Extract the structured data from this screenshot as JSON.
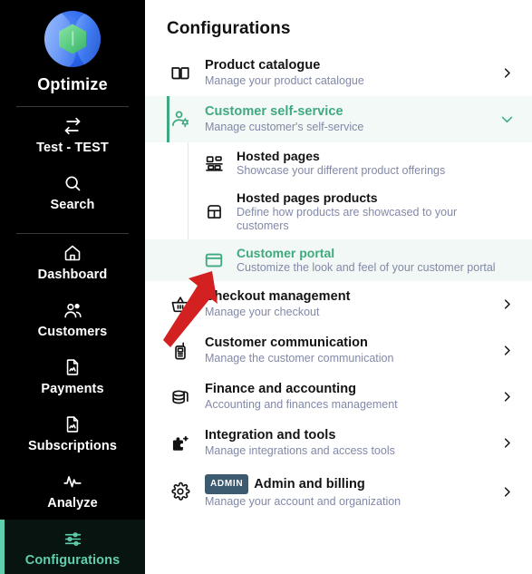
{
  "sidebar": {
    "brand": {
      "name": "Optimize",
      "logo_icon": "optimize-logo",
      "colors": {
        "logo_blue": "#2f6bef",
        "logo_green": "#5fcf86"
      }
    },
    "items": [
      {
        "label": "Test - TEST",
        "icon": "transfer-arrows-icon",
        "active": false
      },
      {
        "label": "Search",
        "icon": "search-icon",
        "active": false
      },
      {
        "label": "Dashboard",
        "icon": "home-icon",
        "active": false
      },
      {
        "label": "Customers",
        "icon": "users-icon",
        "active": false
      },
      {
        "label": "Payments",
        "icon": "document-chart-icon",
        "active": false
      },
      {
        "label": "Subscriptions",
        "icon": "document-chart-icon",
        "active": false
      },
      {
        "label": "Analyze",
        "icon": "pulse-icon",
        "active": false
      },
      {
        "label": "Configurations",
        "icon": "sliders-icon",
        "active": true
      }
    ],
    "active_color": "#5fcfae",
    "background": "#000000"
  },
  "main": {
    "page_title": "Configurations",
    "accent_color": "#3fa97f",
    "subtitle_color": "#8289a8",
    "rows": [
      {
        "title": "Product catalogue",
        "subtitle": "Manage your product catalogue",
        "icon": "book-open-icon",
        "chevron": "chevron-right-icon",
        "selected": false
      },
      {
        "title": "Customer self-service",
        "subtitle": "Manage customer's self-service",
        "icon": "user-settings-icon",
        "chevron": "chevron-down-icon",
        "selected": true,
        "expanded": true
      },
      {
        "title": "Checkout management",
        "subtitle": "Manage your checkout",
        "icon": "shopping-basket-icon",
        "chevron": "chevron-right-icon",
        "selected": false
      },
      {
        "title": "Customer communication",
        "subtitle": "Manage the customer communication",
        "icon": "walkie-talkie-icon",
        "chevron": "chevron-right-icon",
        "selected": false
      },
      {
        "title": "Finance and accounting",
        "subtitle": "Accounting and finances management",
        "icon": "coins-stack-icon",
        "chevron": "chevron-right-icon",
        "selected": false
      },
      {
        "title": "Integration and tools",
        "subtitle": "Manage integrations and access tools",
        "icon": "puzzle-piece-icon",
        "chevron": "chevron-right-icon",
        "selected": false
      },
      {
        "title": "Admin and billing",
        "subtitle": "Manage your account and organization",
        "icon": "gear-icon",
        "chevron": "chevron-right-icon",
        "badge": "ADMIN",
        "badge_color": "#3c5a70",
        "selected": false
      }
    ],
    "subrows": [
      {
        "title": "Hosted pages",
        "subtitle": "Showcase your different product offerings",
        "icon": "layout-grid-icon",
        "selected": false
      },
      {
        "title": "Hosted pages products",
        "subtitle": "Define how products are showcased to your customers",
        "icon": "package-box-icon",
        "selected": false
      },
      {
        "title": "Customer portal",
        "subtitle": "Customize the look and feel of your customer portal",
        "icon": "browser-window-icon",
        "selected": true
      }
    ]
  },
  "annotation": {
    "arrow_color": "#d32020",
    "arrow_icon": "red-pointer-arrow"
  }
}
